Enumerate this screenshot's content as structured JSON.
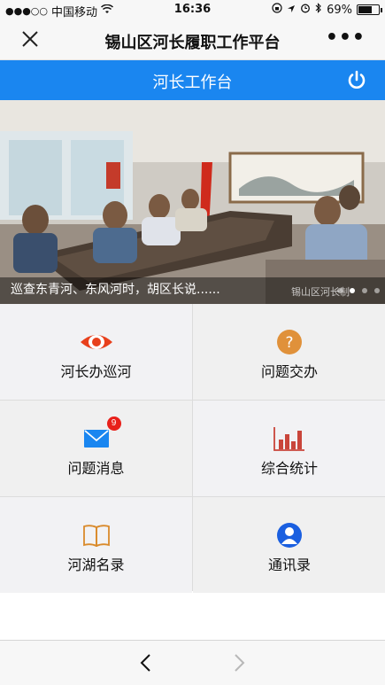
{
  "status_bar": {
    "carrier": "中国移动",
    "time": "16:36",
    "battery": "69%",
    "battery_level": 0.69
  },
  "nav": {
    "title": "锡山区河长履职工作平台",
    "more": "•••"
  },
  "header": {
    "title": "河长工作台"
  },
  "banner": {
    "caption": "巡查东青河、东风河时，胡区长说......",
    "watermark": "锡山区河长制",
    "slide_count": 4,
    "active_slide": 2
  },
  "menu": {
    "items": [
      {
        "label": "河长办巡河",
        "icon": "eye-icon",
        "color": "#e8401c"
      },
      {
        "label": "问题交办",
        "icon": "question-icon",
        "color": "#e0913a"
      },
      {
        "label": "问题消息",
        "icon": "mail-icon",
        "color": "#1a86f0",
        "badge": "9"
      },
      {
        "label": "综合统计",
        "icon": "bar-chart-icon",
        "color": "#c9453a"
      },
      {
        "label": "河湖名录",
        "icon": "book-icon",
        "color": "#d98a2b"
      },
      {
        "label": "通讯录",
        "icon": "contact-icon",
        "color": "#1a5fe0"
      }
    ]
  },
  "colors": {
    "accent": "#1a86f0",
    "badge": "#e8201a"
  }
}
